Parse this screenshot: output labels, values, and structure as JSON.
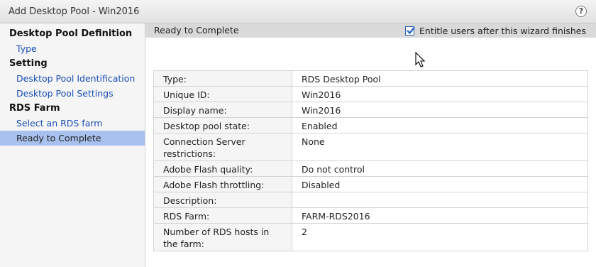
{
  "window": {
    "title": "Add Desktop Pool - Win2016",
    "help_label": "?"
  },
  "sidebar": {
    "sections": [
      {
        "label": "Desktop Pool Definition",
        "items": [
          {
            "label": "Type",
            "active": false
          }
        ]
      },
      {
        "label": "Setting",
        "items": [
          {
            "label": "Desktop Pool Identification",
            "active": false
          },
          {
            "label": "Desktop Pool Settings",
            "active": false
          }
        ]
      },
      {
        "label": "RDS Farm",
        "items": [
          {
            "label": "Select an RDS farm",
            "active": false
          },
          {
            "label": "Ready to Complete",
            "active": true
          }
        ]
      }
    ]
  },
  "main": {
    "header": "Ready to Complete",
    "entitle": {
      "label": "Entitle users after this wizard finishes",
      "checked": true
    },
    "summary": [
      {
        "key": "Type:",
        "value": "RDS Desktop Pool"
      },
      {
        "key": "Unique ID:",
        "value": "Win2016"
      },
      {
        "key": "Display name:",
        "value": "Win2016"
      },
      {
        "key": "Desktop pool state:",
        "value": "Enabled"
      },
      {
        "key": "Connection Server restrictions:",
        "value": "None"
      },
      {
        "key": "Adobe Flash quality:",
        "value": "Do not control"
      },
      {
        "key": "Adobe Flash throttling:",
        "value": "Disabled"
      },
      {
        "key": "Description:",
        "value": ""
      },
      {
        "key": "RDS Farm:",
        "value": "FARM-RDS2016"
      },
      {
        "key": "Number of RDS hosts in the farm:",
        "value": "2"
      }
    ]
  },
  "colors": {
    "accent": "#a9c1ee",
    "link": "#1a4fb5",
    "header_bg": "#d9d9d9"
  }
}
